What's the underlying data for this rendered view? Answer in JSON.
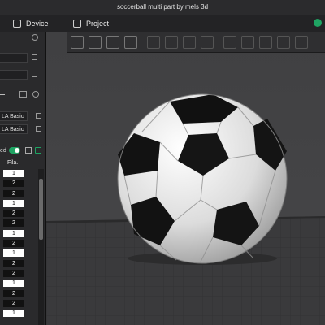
{
  "window": {
    "title": "soccerball multi part by mels 3d"
  },
  "tabs": [
    {
      "label": "Device"
    },
    {
      "label": "Project"
    }
  ],
  "left_panel": {
    "filaments": [
      {
        "label": "LA Basic"
      },
      {
        "label": "LA Basic"
      }
    ],
    "toggle_label": "ed",
    "table_header": "Fila.",
    "rows": [
      {
        "value": "1",
        "style": "light"
      },
      {
        "value": "2",
        "style": "dark"
      },
      {
        "value": "2",
        "style": "dark"
      },
      {
        "value": "1",
        "style": "light"
      },
      {
        "value": "2",
        "style": "dark"
      },
      {
        "value": "2",
        "style": "dark"
      },
      {
        "value": "1",
        "style": "light"
      },
      {
        "value": "2",
        "style": "dark"
      },
      {
        "value": "1",
        "style": "light"
      },
      {
        "value": "2",
        "style": "dark"
      },
      {
        "value": "2",
        "style": "dark"
      },
      {
        "value": "1",
        "style": "light"
      },
      {
        "value": "2",
        "style": "dark"
      },
      {
        "value": "2",
        "style": "dark"
      },
      {
        "value": "1",
        "style": "light"
      },
      {
        "value": "2",
        "style": "dark"
      },
      {
        "value": "2",
        "style": "dark"
      },
      {
        "value": "1",
        "style": "light"
      }
    ]
  },
  "toolbar": {
    "tools": [
      "add-cube-icon",
      "grid-icon",
      "auto-orient-icon",
      "arrange-icon",
      "plate-icon",
      "split-icon",
      "boolean-icon",
      "layers-icon",
      "support-icon",
      "seam-icon",
      "paint-icon",
      "text-icon",
      "measure-icon"
    ]
  },
  "colors": {
    "accent": "#1fa463",
    "background": "#3a3a3d",
    "panel": "#2a2a2c"
  }
}
